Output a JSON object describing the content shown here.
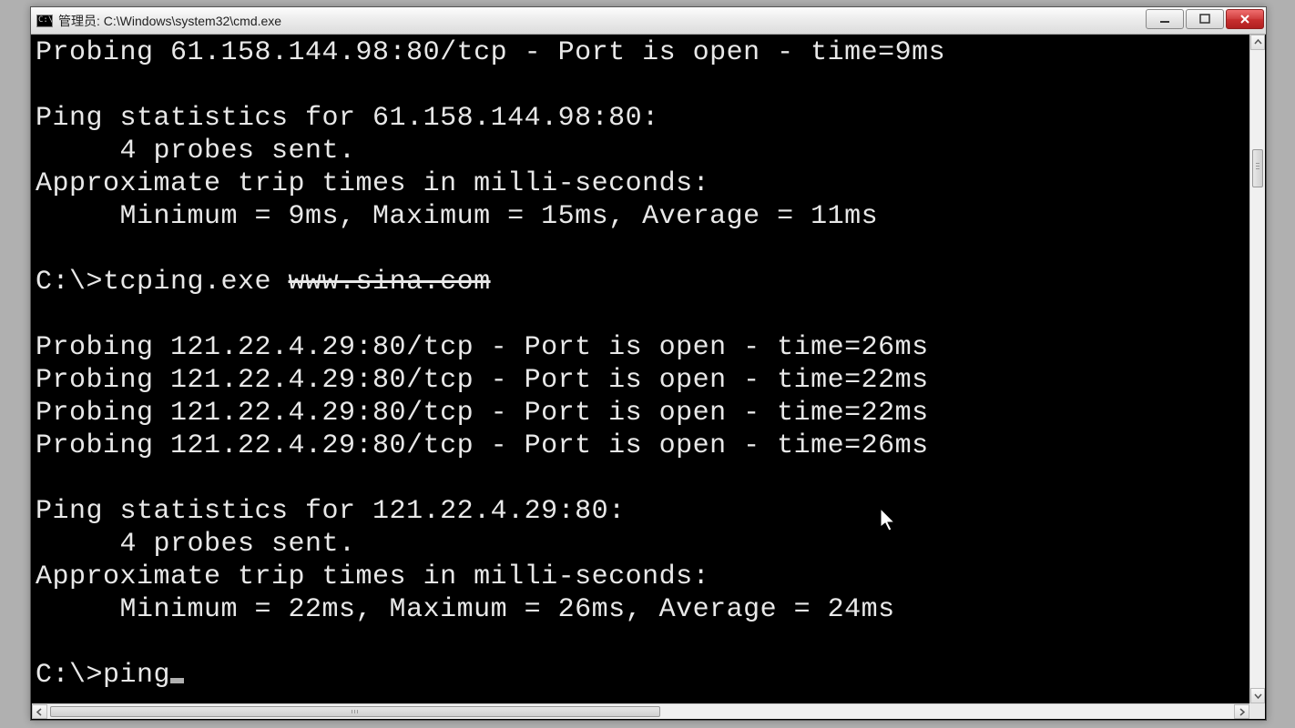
{
  "window": {
    "title": "管理员: C:\\Windows\\system32\\cmd.exe"
  },
  "terminal": {
    "lines": [
      "Probing 61.158.144.98:80/tcp - Port is open - time=9ms",
      "",
      "Ping statistics for 61.158.144.98:80:",
      "     4 probes sent.",
      "Approximate trip times in milli-seconds:",
      "     Minimum = 9ms, Maximum = 15ms, Average = 11ms",
      "",
      "C:\\>tcping.exe ",
      "",
      "Probing 121.22.4.29:80/tcp - Port is open - time=26ms",
      "Probing 121.22.4.29:80/tcp - Port is open - time=22ms",
      "Probing 121.22.4.29:80/tcp - Port is open - time=22ms",
      "Probing 121.22.4.29:80/tcp - Port is open - time=26ms",
      "",
      "Ping statistics for 121.22.4.29:80:",
      "     4 probes sent.",
      "Approximate trip times in milli-seconds:",
      "     Minimum = 22ms, Maximum = 26ms, Average = 24ms",
      "",
      "C:\\>ping"
    ],
    "redacted_append_line_index": 7,
    "redacted_text": "www.sina.com",
    "cursor_after_line_index": 19
  }
}
